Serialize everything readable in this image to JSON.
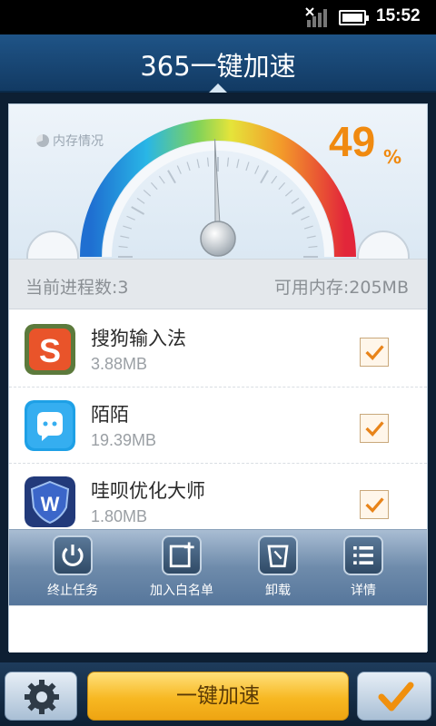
{
  "status_bar": {
    "time": "15:52",
    "icons": [
      "signal-icon",
      "battery-icon"
    ]
  },
  "header": {
    "title": "365一键加速"
  },
  "gauge": {
    "label": "内存情况",
    "percent": "49",
    "percent_sign": "%",
    "level": 0.49
  },
  "stats": {
    "process_count": "当前进程数:3",
    "free_memory": "可用内存:205MB"
  },
  "apps": [
    {
      "name": "搜狗输入法",
      "size": "3.88MB",
      "icon": "sogou-input-icon",
      "checked": true
    },
    {
      "name": "陌陌",
      "size": "19.39MB",
      "icon": "momo-icon",
      "checked": true
    },
    {
      "name": "哇呗优化大师",
      "size": "1.80MB",
      "icon": "wabei-master-icon",
      "checked": true
    }
  ],
  "toolbar": {
    "end_task": "终止任务",
    "add_whitelist": "加入白名单",
    "uninstall": "卸载",
    "details": "详情"
  },
  "bottom": {
    "accelerate_label": "一键加速"
  },
  "colors": {
    "accent": "#f08a10",
    "header": "#1a4a78"
  }
}
